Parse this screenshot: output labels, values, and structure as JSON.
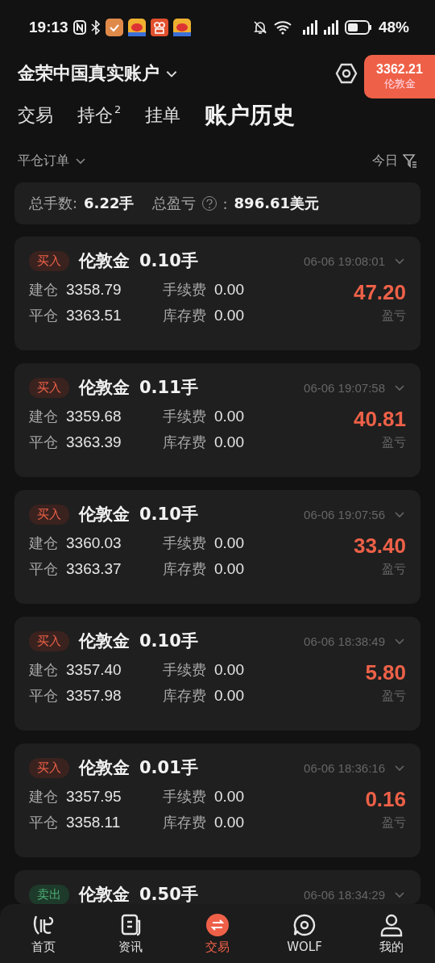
{
  "status_bar": {
    "time": "19:13",
    "battery": "48%"
  },
  "header": {
    "account": "金荣中国真实账户",
    "price_badge": {
      "price": "3362.21",
      "symbol": "伦敦金"
    }
  },
  "tabs": [
    {
      "label": "交易",
      "selected": false
    },
    {
      "label": "持仓",
      "sup": "2",
      "selected": false
    },
    {
      "label": "挂单",
      "selected": false
    },
    {
      "label": "账户历史",
      "selected": true
    }
  ],
  "filter": {
    "order_type": "平仓订单",
    "period": "今日"
  },
  "summary": {
    "lots_label": "总手数:",
    "lots": "6.22手",
    "pl_label": "总盈亏",
    "pl_colon": ":",
    "pl": "896.61美元"
  },
  "orders": [
    {
      "kind": "buy",
      "side": "买入",
      "symbol": "伦敦金",
      "lots": "0.10手",
      "time": "06-06 19:08:01",
      "open_label": "建仓",
      "open": "3358.79",
      "close_label": "平仓",
      "close": "3363.51",
      "fee_label": "手续费",
      "fee": "0.00",
      "swap_label": "库存费",
      "swap": "0.00",
      "profit": "47.20",
      "profit_label": "盈亏"
    },
    {
      "kind": "buy",
      "side": "买入",
      "symbol": "伦敦金",
      "lots": "0.11手",
      "time": "06-06 19:07:58",
      "open_label": "建仓",
      "open": "3359.68",
      "close_label": "平仓",
      "close": "3363.39",
      "fee_label": "手续费",
      "fee": "0.00",
      "swap_label": "库存费",
      "swap": "0.00",
      "profit": "40.81",
      "profit_label": "盈亏"
    },
    {
      "kind": "buy",
      "side": "买入",
      "symbol": "伦敦金",
      "lots": "0.10手",
      "time": "06-06 19:07:56",
      "open_label": "建仓",
      "open": "3360.03",
      "close_label": "平仓",
      "close": "3363.37",
      "fee_label": "手续费",
      "fee": "0.00",
      "swap_label": "库存费",
      "swap": "0.00",
      "profit": "33.40",
      "profit_label": "盈亏"
    },
    {
      "kind": "buy",
      "side": "买入",
      "symbol": "伦敦金",
      "lots": "0.10手",
      "time": "06-06 18:38:49",
      "open_label": "建仓",
      "open": "3357.40",
      "close_label": "平仓",
      "close": "3357.98",
      "fee_label": "手续费",
      "fee": "0.00",
      "swap_label": "库存费",
      "swap": "0.00",
      "profit": "5.80",
      "profit_label": "盈亏"
    },
    {
      "kind": "buy",
      "side": "买入",
      "symbol": "伦敦金",
      "lots": "0.01手",
      "time": "06-06 18:36:16",
      "open_label": "建仓",
      "open": "3357.95",
      "close_label": "平仓",
      "close": "3358.11",
      "fee_label": "手续费",
      "fee": "0.00",
      "swap_label": "库存费",
      "swap": "0.00",
      "profit": "0.16",
      "profit_label": "盈亏"
    },
    {
      "kind": "sell",
      "side": "卖出",
      "symbol": "伦敦金",
      "lots": "0.50手",
      "time": "06-06 18:34:29"
    }
  ],
  "nav": [
    {
      "kind": "home",
      "label": "首页",
      "selected": false
    },
    {
      "kind": "news",
      "label": "资讯",
      "selected": false
    },
    {
      "kind": "trade",
      "label": "交易",
      "selected": true
    },
    {
      "kind": "wolf",
      "label": "WOLF",
      "selected": false
    },
    {
      "kind": "me",
      "label": "我的",
      "selected": false
    }
  ]
}
